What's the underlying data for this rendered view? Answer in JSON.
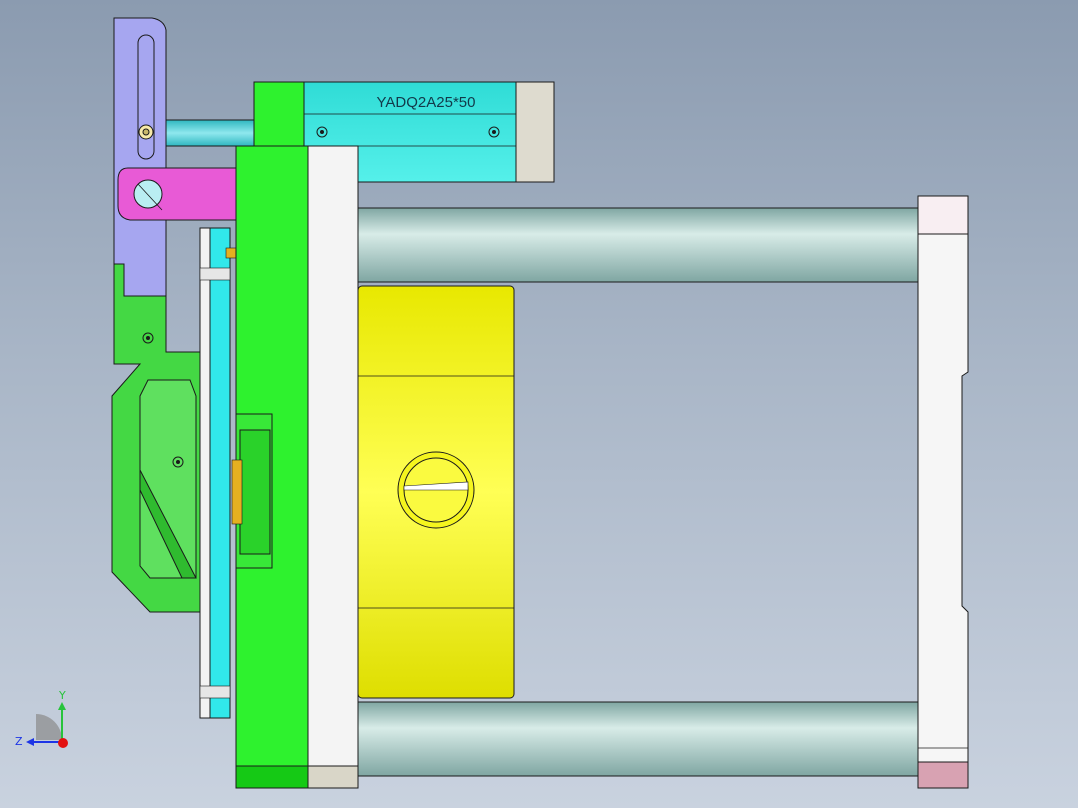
{
  "viewport": {
    "background_top": "#8b9bb0",
    "background_bottom": "#c9d2df"
  },
  "parts": {
    "cylinder_label": "YADQ2A25*50"
  },
  "triad": {
    "y_label": "Y",
    "z_label": "Z",
    "y_color": "#27c33b",
    "z_color": "#1d35e6",
    "origin_color": "#e31010"
  },
  "colors": {
    "outline": "#1a1a1a",
    "purple_plate": "#a6a6f0",
    "magenta_block": "#e85ad6",
    "cyan_cylinder": "#3fe6e0",
    "green_plate": "#2ef22e",
    "yellow_block": "#f2f21a",
    "rod": "#9fc7c2",
    "white_plate": "#f4f4f4",
    "pink_cap": "#e8b4c4"
  }
}
